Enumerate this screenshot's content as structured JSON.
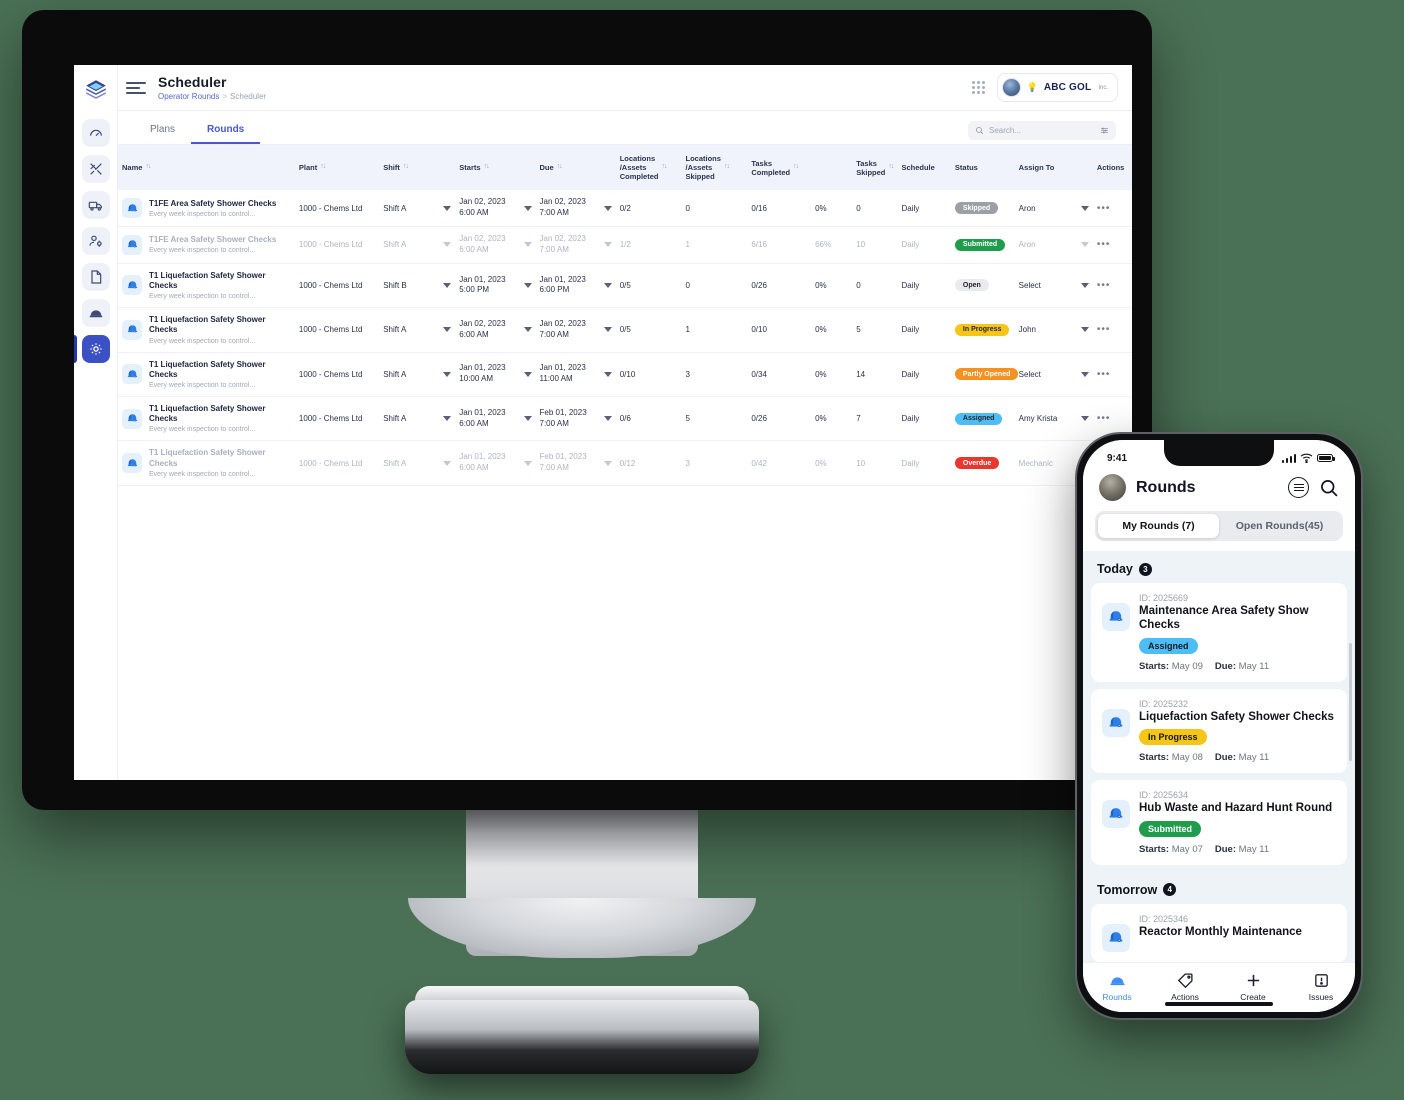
{
  "background_color": "#4a7055",
  "desktop": {
    "sidebar": {
      "logo_name": "layers-logo-icon",
      "items": [
        {
          "icon": "gauge-icon",
          "active": false
        },
        {
          "icon": "tools-icon",
          "active": false
        },
        {
          "icon": "truck-icon",
          "active": false
        },
        {
          "icon": "user-settings-icon",
          "active": false
        },
        {
          "icon": "document-icon",
          "active": false
        },
        {
          "icon": "helmet-icon",
          "active": false
        },
        {
          "icon": "gear-icon",
          "active": true
        }
      ]
    },
    "header": {
      "title": "Scheduler",
      "breadcrumb_parent": "Operator Rounds",
      "breadcrumb_separator": ">",
      "breadcrumb_current": "Scheduler",
      "brand_name": "ABC GOL",
      "brand_sub": "Inc.",
      "apps_icon": "grid-apps-icon",
      "avatar_icon": "user-avatar"
    },
    "tabs": [
      {
        "label": "Plans",
        "active": false
      },
      {
        "label": "Rounds",
        "active": true
      }
    ],
    "search": {
      "placeholder": "Search...",
      "icon": "search-icon",
      "filter_icon": "filter-sliders-icon"
    },
    "table": {
      "columns": [
        {
          "label": "Name",
          "sortable": true
        },
        {
          "label": "Plant",
          "sortable": true
        },
        {
          "label": "Shift",
          "sortable": true
        },
        {
          "label": "Starts",
          "sortable": true
        },
        {
          "label": "Due",
          "sortable": true
        },
        {
          "label": "Locations\n/Assets\nCompleted",
          "sortable": true
        },
        {
          "label": "Locations\n/Assets\nSkipped",
          "sortable": true
        },
        {
          "label": "Tasks\nCompleted",
          "sortable": true
        },
        {
          "label": "Tasks\nSkipped",
          "sortable": true
        },
        {
          "label": "Schedule",
          "sortable": false
        },
        {
          "label": "Status",
          "sortable": false
        },
        {
          "label": "Assign To",
          "sortable": false
        },
        {
          "label": "Actions",
          "sortable": false
        }
      ],
      "sort_glyph": "↑↓",
      "rows": [
        {
          "name": "T1FE Area Safety Shower Checks",
          "desc": "Every week inspection to control...",
          "plant": "1000 - Chems Ltd",
          "shift": "Shift A",
          "starts_date": "Jan 02, 2023",
          "starts_time": "6:00 AM",
          "due_date": "Jan 02, 2023",
          "due_time": "7:00 AM",
          "loc_completed": "0/2",
          "loc_skipped": "0",
          "tasks_completed": "0/16",
          "tasks_pct": "0%",
          "tasks_skipped": "0",
          "schedule": "Daily",
          "status": "Skipped",
          "status_color": "#9aa0a6",
          "assign_to": "Aron",
          "dim": false
        },
        {
          "name": "T1FE Area Safety Shower Checks",
          "desc": "Every week inspection to control...",
          "plant": "1000 - Chems Ltd",
          "shift": "Shift A",
          "starts_date": "Jan 02, 2023",
          "starts_time": "6:00 AM",
          "due_date": "Jan 02, 2023",
          "due_time": "7:00 AM",
          "loc_completed": "1/2",
          "loc_skipped": "1",
          "tasks_completed": "6/16",
          "tasks_pct": "66%",
          "tasks_skipped": "10",
          "schedule": "Daily",
          "status": "Submitted",
          "status_color": "#1f9d4d",
          "assign_to": "Aron",
          "dim": true
        },
        {
          "name": "T1 Liquefaction Safety Shower Checks",
          "desc": "Every week inspection to control...",
          "plant": "1000 - Chems Ltd",
          "shift": "Shift B",
          "starts_date": "Jan 01, 2023",
          "starts_time": "5:00 PM",
          "due_date": "Jan 01, 2023",
          "due_time": "6:00 PM",
          "loc_completed": "0/5",
          "loc_skipped": "0",
          "tasks_completed": "0/26",
          "tasks_pct": "0%",
          "tasks_skipped": "0",
          "schedule": "Daily",
          "status": "Open",
          "status_color": "#e8eaed",
          "status_text_color": "#23262e",
          "assign_to": "Select",
          "dim": false
        },
        {
          "name": "T1 Liquefaction Safety Shower Checks",
          "desc": "Every week inspection to control...",
          "plant": "1000 - Chems Ltd",
          "shift": "Shift A",
          "starts_date": "Jan 02, 2023",
          "starts_time": "6:00 AM",
          "due_date": "Jan 02, 2023",
          "due_time": "7:00 AM",
          "loc_completed": "0/5",
          "loc_skipped": "1",
          "tasks_completed": "0/10",
          "tasks_pct": "0%",
          "tasks_skipped": "5",
          "schedule": "Daily",
          "status": "In Progress",
          "status_color": "#f5c518",
          "status_text_color": "#23262e",
          "assign_to": "John",
          "dim": false
        },
        {
          "name": "T1 Liquefaction Safety Shower Checks",
          "desc": "Every week inspection to control...",
          "plant": "1000 - Chems Ltd",
          "shift": "Shift A",
          "starts_date": "Jan 01, 2023",
          "starts_time": "10:00 AM",
          "due_date": "Jan 01, 2023",
          "due_time": "11:00 AM",
          "loc_completed": "0/10",
          "loc_skipped": "3",
          "tasks_completed": "0/34",
          "tasks_pct": "0%",
          "tasks_skipped": "14",
          "schedule": "Daily",
          "status": "Partly Opened",
          "status_color": "#f59120",
          "assign_to": "Select",
          "dim": false
        },
        {
          "name": "T1 Liquefaction Safety Shower Checks",
          "desc": "Every week inspection to control...",
          "plant": "1000 - Chems Ltd",
          "shift": "Shift A",
          "starts_date": "Jan 01, 2023",
          "starts_time": "6:00 AM",
          "due_date": "Feb 01, 2023",
          "due_time": "7:00 AM",
          "loc_completed": "0/6",
          "loc_skipped": "5",
          "tasks_completed": "0/26",
          "tasks_pct": "0%",
          "tasks_skipped": "7",
          "schedule": "Daily",
          "status": "Assigned",
          "status_color": "#4fbdf5",
          "status_text_color": "#23262e",
          "assign_to": "Amy Krista",
          "dim": false
        },
        {
          "name": "T1 Liquefaction Safety Shower Checks",
          "desc": "Every week inspection to control...",
          "plant": "1000 - Chems Ltd",
          "shift": "Shift A",
          "starts_date": "Jan 01, 2023",
          "starts_time": "6:00 AM",
          "due_date": "Feb 01, 2023",
          "due_time": "7:00 AM",
          "loc_completed": "0/12",
          "loc_skipped": "3",
          "tasks_completed": "0/42",
          "tasks_pct": "0%",
          "tasks_skipped": "10",
          "schedule": "Daily",
          "status": "Overdue",
          "status_color": "#e8372c",
          "assign_to": "Mechanic",
          "dim": true
        }
      ],
      "actions_glyph": "•••"
    }
  },
  "phone": {
    "status_bar": {
      "time": "9:41",
      "signal_icon": "cellular-bars-icon",
      "wifi_icon": "wifi-icon",
      "battery_icon": "battery-icon"
    },
    "header": {
      "title": "Rounds",
      "filter_icon": "filter-circle-icon",
      "search_icon": "search-icon",
      "avatar_icon": "user-avatar"
    },
    "segments": [
      {
        "label": "My Rounds (7)",
        "active": true
      },
      {
        "label": "Open Rounds(45)",
        "active": false
      }
    ],
    "groups": [
      {
        "title": "Today",
        "count": "3",
        "cards": [
          {
            "id_label": "ID: 2025669",
            "title": "Maintenance Area Safety Show Checks",
            "status": "Assigned",
            "status_color": "#4fbdf5",
            "status_text_color": "#15181f",
            "starts_label": "Starts:",
            "starts_value": "May 09",
            "due_label": "Due:",
            "due_value": "May 11"
          },
          {
            "id_label": "ID: 2025232",
            "title": "Liquefaction Safety Shower Checks",
            "status": "In Progress",
            "status_color": "#f5c518",
            "status_text_color": "#15181f",
            "starts_label": "Starts:",
            "starts_value": "May 08",
            "due_label": "Due:",
            "due_value": "May 11"
          },
          {
            "id_label": "ID: 2025634",
            "title": "Hub Waste and Hazard Hunt Round",
            "status": "Submitted",
            "status_color": "#1f9d4d",
            "status_text_color": "#ffffff",
            "starts_label": "Starts:",
            "starts_value": "May 07",
            "due_label": "Due:",
            "due_value": "May 11"
          }
        ]
      },
      {
        "title": "Tomorrow",
        "count": "4",
        "cards": [
          {
            "id_label": "ID: 2025346",
            "title": "Reactor Monthly Maintenance",
            "status": "",
            "status_color": "#4fbdf5",
            "status_text_color": "#15181f",
            "starts_label": "",
            "starts_value": "",
            "due_label": "",
            "due_value": ""
          }
        ]
      }
    ],
    "tabbar": [
      {
        "label": "Rounds",
        "icon": "helmet-icon",
        "active": true
      },
      {
        "label": "Actions",
        "icon": "tag-icon",
        "active": false
      },
      {
        "label": "Create",
        "icon": "plus-icon",
        "active": false
      },
      {
        "label": "Issues",
        "icon": "issue-box-icon",
        "active": false
      }
    ]
  }
}
